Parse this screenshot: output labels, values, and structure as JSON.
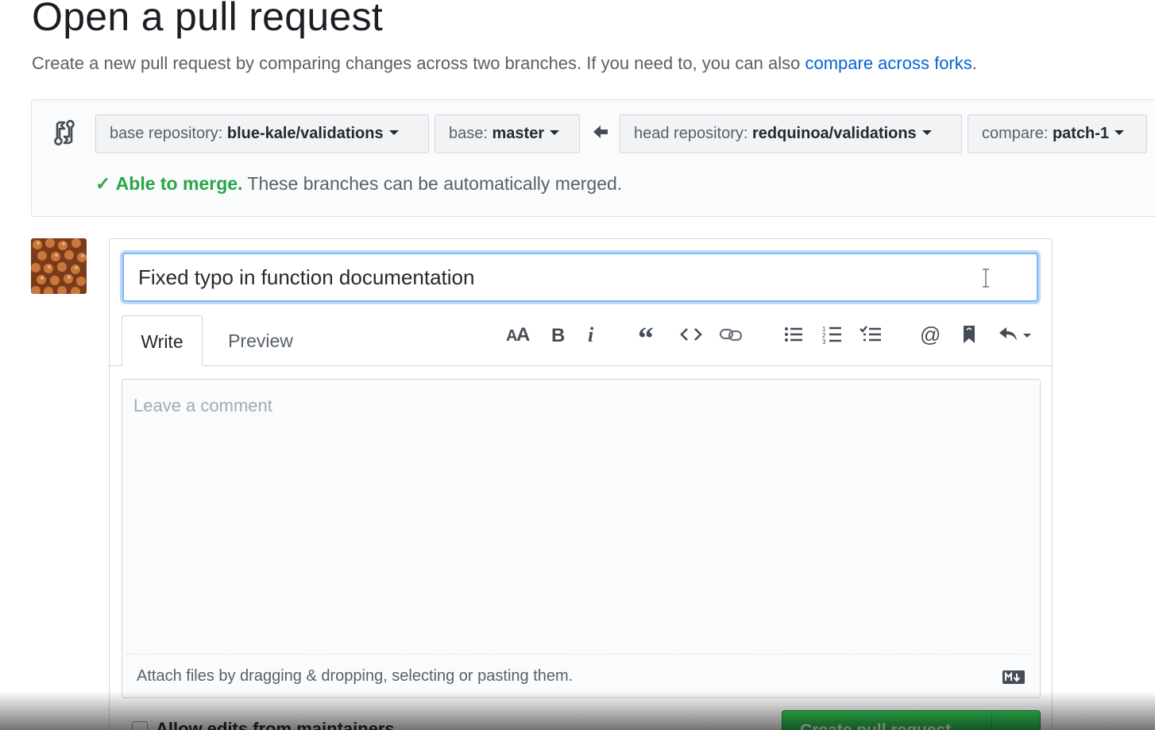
{
  "header": {
    "title": "Open a pull request",
    "subtitle": "Create a new pull request by comparing changes across two branches. If you need to, you can also",
    "subtitle_link": "compare across forks",
    "subtitle_end": "."
  },
  "compare": {
    "base_repo_prefix": "base repository:",
    "base_repo": "blue-kale/validations",
    "base_prefix": "base:",
    "base": "master",
    "head_repo_prefix": "head repository:",
    "head_repo": "redquinoa/validations",
    "compare_prefix": "compare:",
    "compare": "patch-1",
    "merge_check": "✓",
    "merge_ok": "Able to merge.",
    "merge_text": "These branches can be automatically merged."
  },
  "form": {
    "title_value": "Fixed typo in function documentation",
    "tabs": {
      "write": "Write",
      "preview": "Preview"
    },
    "toolbar": [
      "header-icon",
      "bold-icon",
      "italic-icon",
      "quote-icon",
      "code-icon",
      "link-icon",
      "unordered-list-icon",
      "ordered-list-icon",
      "task-list-icon",
      "mention-icon",
      "bookmark-icon",
      "reply-icon"
    ],
    "comment_placeholder": "Leave a comment",
    "attach_text": "Attach files by dragging & dropping, selecting or pasting them.",
    "create_button": "Create pull request",
    "allow_edits": "Allow edits from maintainers"
  },
  "colors": {
    "accent_link": "#0366d6",
    "success": "#28a745",
    "focus_border": "#79b8ff"
  }
}
